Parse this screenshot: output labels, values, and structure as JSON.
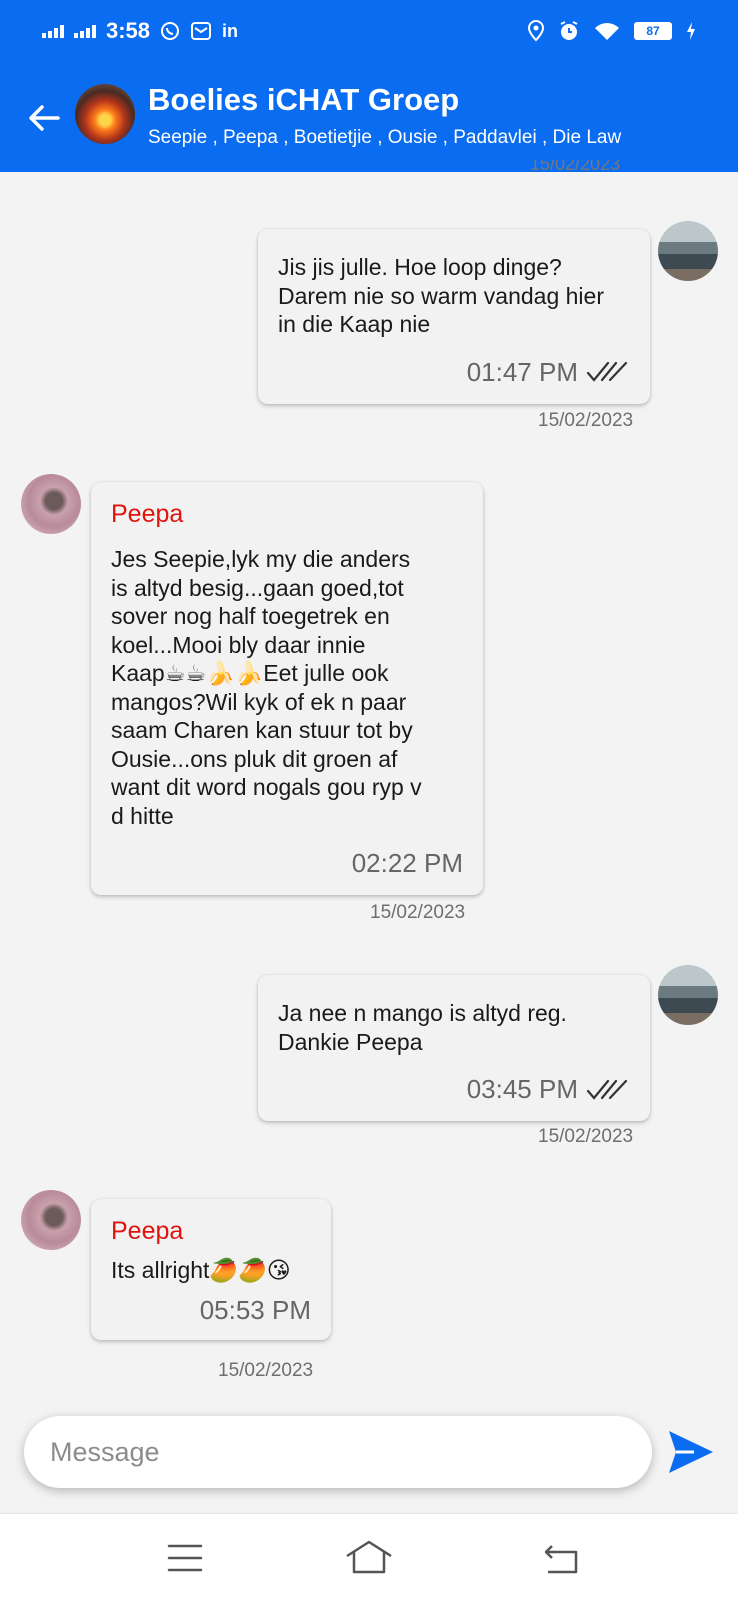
{
  "status_bar": {
    "time": "3:58",
    "icons": [
      "signal-icon",
      "signal-icon",
      "whatsapp-icon",
      "mail-icon",
      "linkedin-icon",
      "location-icon",
      "alarm-icon",
      "wifi-icon",
      "battery-icon",
      "charging-icon"
    ],
    "linkedin": "in",
    "battery": "87"
  },
  "header": {
    "title": "Boelies iCHAT Groep",
    "members": "Seepie , Peepa , Boetietjie , Ousie , Paddavlei , Die Law",
    "accent": "#0a6cf0"
  },
  "messages": [
    {
      "outgoing": true,
      "text": "Jis jis julle. Hoe loop dinge?\nDarem nie so warm vandag hier\nin die Kaap nie",
      "time": "01:47 PM",
      "date": "15/02/2023",
      "read": "read-receipt-icon"
    },
    {
      "outgoing": false,
      "sender": "Peepa",
      "text": "Jes Seepie,lyk my die anders\nis altyd besig...gaan goed,tot\nsover nog half toegetrek en\nkoel...Mooi bly daar innie\nKaap☕☕🍌🍌Eet julle ook\nmangos?Wil kyk of ek n paar\nsaam Charen kan stuur tot by\nOusie...ons pluk dit groen af\nwant dit word nogals gou ryp v\nd hitte",
      "time": "02:22 PM",
      "date": "15/02/2023"
    },
    {
      "outgoing": true,
      "text": "Ja nee n mango is altyd reg.\nDankie Peepa",
      "time": "03:45 PM",
      "date": "15/02/2023",
      "read": "read-receipt-icon"
    },
    {
      "outgoing": false,
      "sender": "Peepa",
      "text": "Its allright🥭🥭😘",
      "time": "05:53 PM",
      "date": "15/02/2023"
    }
  ],
  "composer": {
    "placeholder": "Message",
    "send_icon": "send-icon"
  },
  "colors": {
    "sender_name": "#e0130d",
    "background": "#f3f3f3"
  }
}
